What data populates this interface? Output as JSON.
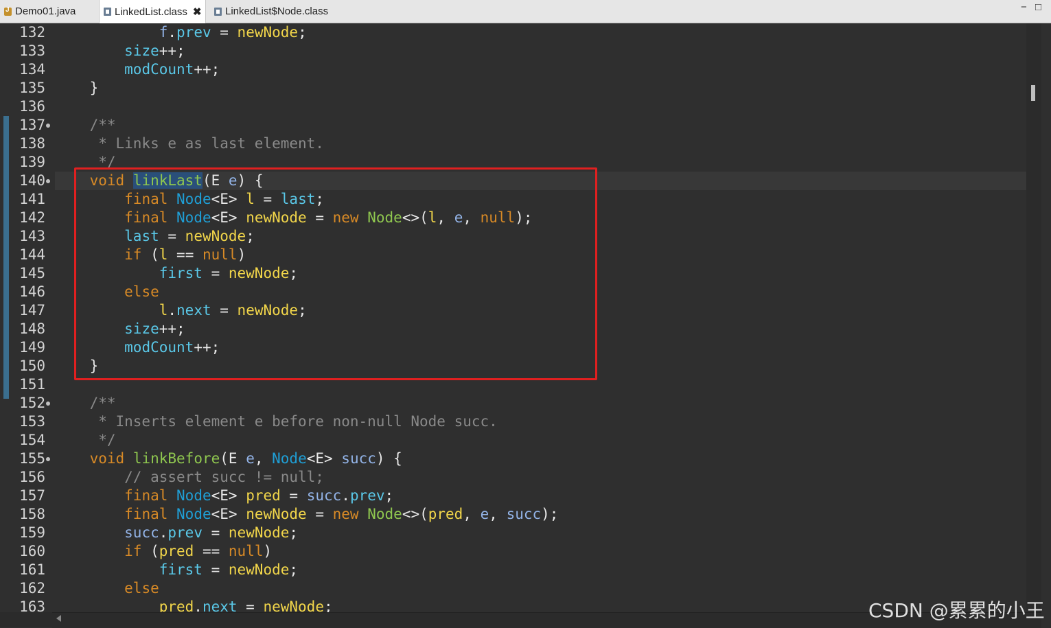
{
  "tabs": [
    {
      "label": "Demo01.java",
      "icon": "java-file-icon",
      "active": false
    },
    {
      "label": "LinkedList.class",
      "icon": "class-file-icon",
      "active": true,
      "close": "✖"
    },
    {
      "label": "LinkedList$Node.class",
      "icon": "class-file-icon",
      "active": false
    }
  ],
  "window_controls": {
    "minimize": "−",
    "maximize": "□"
  },
  "line_numbers": [
    "132",
    "133",
    "134",
    "135",
    "136",
    "137",
    "138",
    "139",
    "140",
    "141",
    "142",
    "143",
    "144",
    "145",
    "146",
    "147",
    "148",
    "149",
    "150",
    "151",
    "152",
    "153",
    "154",
    "155",
    "156",
    "157",
    "158",
    "159",
    "160",
    "161",
    "162",
    "163"
  ],
  "code_lines": [
    "        f.prev = newNode;",
    "    size++;",
    "    modCount++;",
    "}",
    "",
    "/**",
    " * Links e as last element.",
    " */",
    "void linkLast(E e) {",
    "    final Node<E> l = last;",
    "    final Node<E> newNode = new Node<>(l, e, null);",
    "    last = newNode;",
    "    if (l == null)",
    "        first = newNode;",
    "    else",
    "        l.next = newNode;",
    "    size++;",
    "    modCount++;",
    "}",
    "",
    "/**",
    " * Inserts element e before non-null Node succ.",
    " */",
    "void linkBefore(E e, Node<E> succ) {",
    "    // assert succ != null;",
    "    final Node<E> pred = succ.prev;",
    "    final Node<E> newNode = new Node<>(pred, e, succ);",
    "    succ.prev = newNode;",
    "    if (pred == null)",
    "        first = newNode;",
    "    else",
    "        pred.next = newNode;"
  ],
  "current_line": "140",
  "selected_word": "linkLast",
  "colors": {
    "keyword": "#d88a26",
    "field": "#5ac8e8",
    "type": "#1f9fd6",
    "method": "#8fc74f",
    "local_var": "#f2d64a",
    "param": "#93b4e8",
    "comment": "#8a8a8a",
    "highlight_box": "#e02020",
    "background": "#2f2f2f"
  },
  "watermark": "CSDN @累累的小王"
}
